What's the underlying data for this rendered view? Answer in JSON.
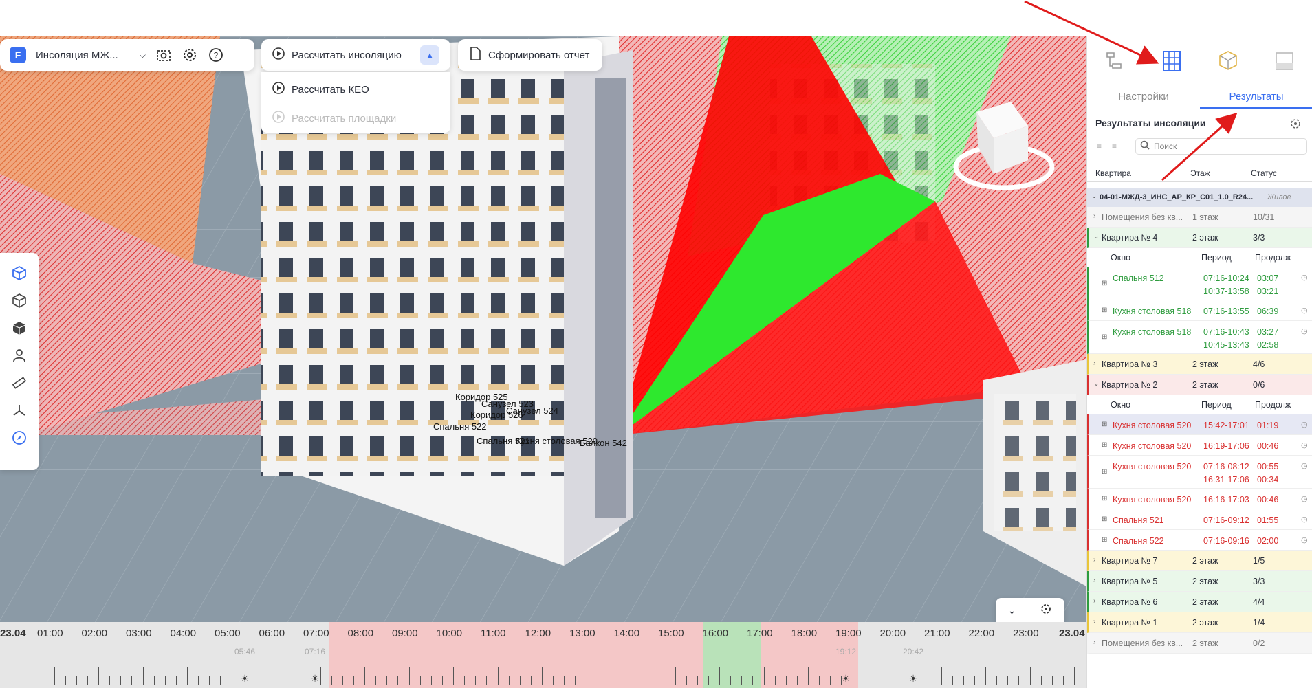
{
  "app": {
    "logo_letter": "F",
    "project": "Инсоляция МЖ...",
    "calc_insolation": "Рассчитать инсоляцию",
    "report": "Сформировать отчет",
    "calc_keo": "Рассчитать КЕО",
    "calc_areas": "Рассчитать площадки"
  },
  "scene_labels": [
    "Коридор 525",
    "Санузел 523",
    "Санузел 524",
    "Коридор 526",
    "Спальня 522",
    "Спальня 521",
    "Кухня столовая 520",
    "Балкон 542"
  ],
  "timeline": {
    "start": "23.04",
    "end": "23.04",
    "hours": [
      "01:00",
      "02:00",
      "03:00",
      "04:00",
      "05:00",
      "06:00",
      "07:00",
      "08:00",
      "09:00",
      "10:00",
      "11:00",
      "12:00",
      "13:00",
      "14:00",
      "15:00",
      "16:00",
      "17:00",
      "18:00",
      "19:00",
      "20:00",
      "21:00",
      "22:00",
      "23:00"
    ],
    "markers": [
      "05:46",
      "07:16",
      "19:12",
      "20:42"
    ]
  },
  "panel": {
    "tabs": [
      "Настройки",
      "Результаты"
    ],
    "title": "Результаты инсоляции",
    "search_placeholder": "Поиск",
    "columns": [
      "Квартира",
      "Этаж",
      "Статус"
    ],
    "project_row": "04-01-МЖД-3_ИНС_АР_КР_С01_1.0_R24...",
    "project_type": "Жилое",
    "sub_columns": [
      "Окно",
      "Период",
      "Продолж"
    ],
    "rows": [
      {
        "name": "Помещения без кв...",
        "floor": "1 этаж",
        "status": "10/31",
        "kind": "group"
      },
      {
        "name": "Квартира № 4",
        "floor": "2 этаж",
        "status": "3/3",
        "kind": "ok",
        "expanded": true
      },
      {
        "name": "Спальня 512",
        "period": "07:16-10:24",
        "dur": "03:07",
        "period2": "10:37-13:58",
        "dur2": "03:21",
        "kind": "ok-item"
      },
      {
        "name": "Кухня столовая 518",
        "period": "07:16-13:55",
        "dur": "06:39",
        "kind": "ok-item"
      },
      {
        "name": "Кухня столовая 518",
        "period": "07:16-10:43",
        "dur": "03:27",
        "period2": "10:45-13:43",
        "dur2": "02:58",
        "kind": "ok-item"
      },
      {
        "name": "Квартира № 3",
        "floor": "2 этаж",
        "status": "4/6",
        "kind": "warn"
      },
      {
        "name": "Квартира № 2",
        "floor": "2 этаж",
        "status": "0/6",
        "kind": "bad",
        "expanded": true
      },
      {
        "name": "Кухня столовая 520",
        "period": "15:42-17:01",
        "dur": "01:19",
        "kind": "bad-item"
      },
      {
        "name": "Кухня столовая 520",
        "period": "16:19-17:06",
        "dur": "00:46",
        "kind": "bad-item"
      },
      {
        "name": "Кухня столовая 520",
        "period": "07:16-08:12",
        "dur": "00:55",
        "period2": "16:31-17:06",
        "dur2": "00:34",
        "kind": "bad-item"
      },
      {
        "name": "Кухня столовая 520",
        "period": "16:16-17:03",
        "dur": "00:46",
        "kind": "bad-item"
      },
      {
        "name": "Спальня 521",
        "period": "07:16-09:12",
        "dur": "01:55",
        "kind": "bad-item"
      },
      {
        "name": "Спальня 522",
        "period": "07:16-09:16",
        "dur": "02:00",
        "kind": "bad-item"
      },
      {
        "name": "Квартира № 7",
        "floor": "2 этаж",
        "status": "1/5",
        "kind": "warn"
      },
      {
        "name": "Квартира № 5",
        "floor": "2 этаж",
        "status": "3/3",
        "kind": "ok"
      },
      {
        "name": "Квартира № 6",
        "floor": "2 этаж",
        "status": "4/4",
        "kind": "ok"
      },
      {
        "name": "Квартира № 1",
        "floor": "2 этаж",
        "status": "1/4",
        "kind": "warn"
      },
      {
        "name": "Помещения без кв...",
        "floor": "2 этаж",
        "status": "0/2",
        "kind": "group"
      }
    ]
  },
  "colors": {
    "accent": "#3a6ff0",
    "ok": "#2e9c3e",
    "bad": "#d93030",
    "ok_bg": "#eaf7ea",
    "bad_bg": "#fbe9e9",
    "warn_bg": "#fdf6d8"
  }
}
